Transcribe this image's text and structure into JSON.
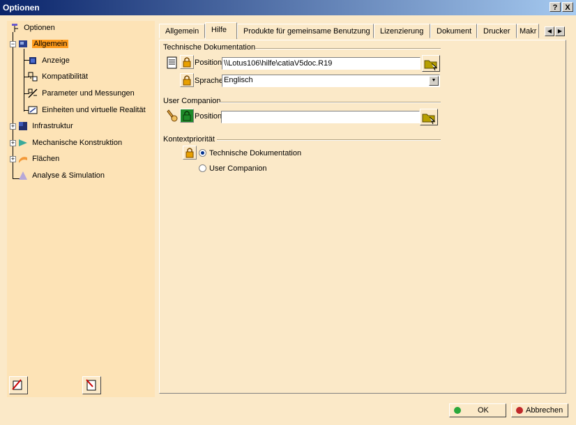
{
  "window": {
    "title": "Optionen",
    "help_glyph": "?",
    "close_glyph": "X"
  },
  "tree": {
    "root": "Optionen",
    "items": [
      {
        "label": "Allgemein",
        "icon": "general-icon"
      },
      {
        "label": "Anzeige",
        "icon": "display-icon"
      },
      {
        "label": "Kompatibilität",
        "icon": "compatibility-icon"
      },
      {
        "label": "Parameter und Messungen",
        "icon": "parameters-icon"
      },
      {
        "label": "Einheiten und virtuelle Realität",
        "icon": "units-vr-icon"
      },
      {
        "label": "Infrastruktur",
        "icon": "infrastructure-icon"
      },
      {
        "label": "Mechanische Konstruktion",
        "icon": "mechanical-design-icon"
      },
      {
        "label": "Flächen",
        "icon": "surfaces-icon"
      },
      {
        "label": "Analyse & Simulation",
        "icon": "analysis-simulation-icon"
      }
    ]
  },
  "tabs": [
    "Allgemein",
    "Hilfe",
    "Produkte für gemeinsame Benutzung",
    "Lizenzierung",
    "Dokument",
    "Drucker",
    "Makr"
  ],
  "active_tab": "Hilfe",
  "tech_doc": {
    "title": "Technische Dokumentation",
    "position_label": "Position",
    "position_value": "\\\\Lotus106\\hilfe\\catiaV5doc.R19",
    "language_label": "Sprache",
    "language_value": "Englisch"
  },
  "companion": {
    "title": "User Companion",
    "position_label": "Position",
    "position_value": ""
  },
  "priority": {
    "title": "Kontextpriorität",
    "options": [
      "Technische Dokumentation",
      "User Companion"
    ],
    "selected": "Technische Dokumentation"
  },
  "buttons": {
    "ok": "OK",
    "cancel": "Abbrechen"
  },
  "colors": {
    "accent_selected": "#ff9a1a",
    "title_bar": "#0a246a",
    "panel_bg": "#fbe9c8"
  }
}
